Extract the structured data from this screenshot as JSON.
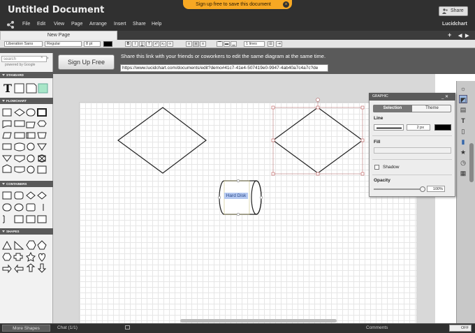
{
  "title": "Untitled Document",
  "promo": "Sign up free to save this document",
  "share_button": "Share",
  "menu": [
    "File",
    "Edit",
    "View",
    "Page",
    "Arrange",
    "Insert",
    "Share",
    "Help"
  ],
  "brand": "Lucidchart",
  "page_tab": "New Page",
  "toolbar": {
    "font": "Liberation Sans",
    "style": "Regular",
    "size": "8 pt",
    "line": "1 lines"
  },
  "sharebar": {
    "signup_label": "Sign Up Free",
    "message": "Share this link with your friends or coworkers to edit the same diagram at the same time.",
    "url": "https://www.lucidchart.com/documents/edit?demo#41c7-41e4-507419e0-9947-4ab40a7c4a7c?de"
  },
  "search": {
    "placeholder": "search",
    "powered": "powered by Google"
  },
  "sections": {
    "standard": "STANDARD",
    "flowchart": "FLOWCHART",
    "containers": "CONTAINERS",
    "shapes": "SHAPES"
  },
  "canvas": {
    "cylinder_label": "Hard Disk"
  },
  "graphic_panel": {
    "title": "GRAPHIC",
    "tab_selection": "Selection",
    "tab_theme": "Theme",
    "line_label": "Line",
    "line_width": "2 px",
    "line_color": "#000000",
    "fill_label": "Fill",
    "shadow_label": "Shadow",
    "opacity_label": "Opacity",
    "opacity_value": "100%"
  },
  "status": {
    "more_shapes": "More Shapes",
    "chat": "Chat (1/1)",
    "comments": "Comments",
    "toggle": "OFF"
  }
}
